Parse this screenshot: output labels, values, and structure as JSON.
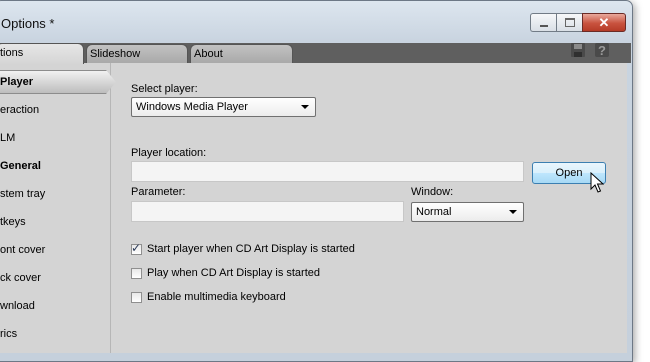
{
  "window": {
    "title": "Options *",
    "controls": {
      "minimize": "minimize",
      "maximize": "maximize",
      "close": "close"
    }
  },
  "tabs": [
    {
      "label": "tions",
      "active": true
    },
    {
      "label": "Slideshow",
      "active": false
    },
    {
      "label": "About",
      "active": false
    }
  ],
  "tab_icons": [
    "save-icon",
    "help-icon"
  ],
  "sidebar": {
    "items": [
      {
        "label": "Player",
        "bold": true,
        "selected": true
      },
      {
        "label": "eraction",
        "bold": false,
        "selected": false
      },
      {
        "label": "LM",
        "bold": false,
        "selected": false
      },
      {
        "label": "General",
        "bold": true,
        "selected": false
      },
      {
        "label": "stem tray",
        "bold": false,
        "selected": false
      },
      {
        "label": "tkeys",
        "bold": false,
        "selected": false
      },
      {
        "label": "ont cover",
        "bold": false,
        "selected": false
      },
      {
        "label": "ck cover",
        "bold": false,
        "selected": false
      },
      {
        "label": "wnload",
        "bold": false,
        "selected": false
      },
      {
        "label": "rics",
        "bold": false,
        "selected": false
      }
    ]
  },
  "player": {
    "select_label": "Select player:",
    "selected_player": "Windows Media Player",
    "location_label": "Player location:",
    "location_value": "",
    "open_button": "Open",
    "parameter_label": "Parameter:",
    "parameter_value": "",
    "window_label": "Window:",
    "window_value": "Normal"
  },
  "options": [
    {
      "label": "Start player when CD Art Display is started",
      "checked": true
    },
    {
      "label": "Play when CD Art Display is started",
      "checked": false
    },
    {
      "label": "Enable multimedia keyboard",
      "checked": false
    }
  ]
}
